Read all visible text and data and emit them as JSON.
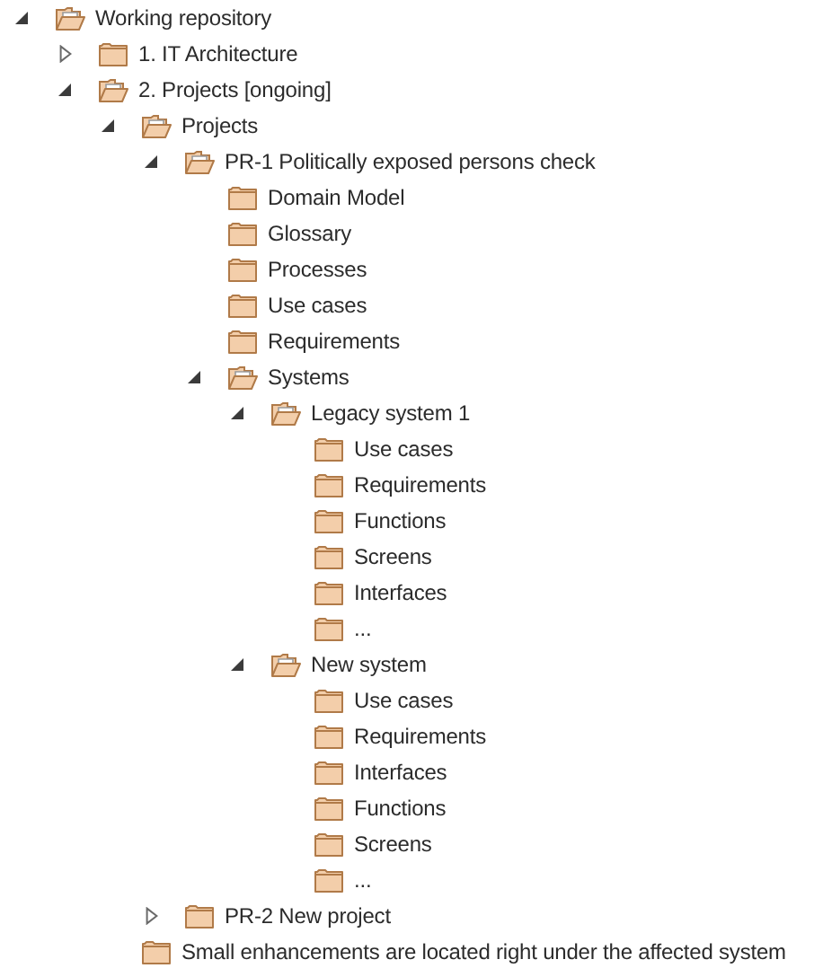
{
  "tree": [
    {
      "label": "Working repository",
      "expanded": true,
      "children": [
        {
          "label": "1. IT Architecture",
          "expanded": false
        },
        {
          "label": "2. Projects [ongoing]",
          "expanded": true,
          "children": [
            {
              "label": "Projects",
              "expanded": true,
              "children": [
                {
                  "label": "PR-1 Politically exposed persons check",
                  "expanded": true,
                  "children": [
                    {
                      "label": "Domain Model"
                    },
                    {
                      "label": "Glossary"
                    },
                    {
                      "label": "Processes"
                    },
                    {
                      "label": "Use cases"
                    },
                    {
                      "label": "Requirements"
                    },
                    {
                      "label": "Systems",
                      "expanded": true,
                      "children": [
                        {
                          "label": "Legacy system 1",
                          "expanded": true,
                          "children": [
                            {
                              "label": "Use cases"
                            },
                            {
                              "label": "Requirements"
                            },
                            {
                              "label": "Functions"
                            },
                            {
                              "label": "Screens"
                            },
                            {
                              "label": "Interfaces"
                            },
                            {
                              "label": "..."
                            }
                          ]
                        },
                        {
                          "label": "New system",
                          "expanded": true,
                          "children": [
                            {
                              "label": "Use cases"
                            },
                            {
                              "label": "Requirements"
                            },
                            {
                              "label": "Interfaces"
                            },
                            {
                              "label": "Functions"
                            },
                            {
                              "label": "Screens"
                            },
                            {
                              "label": "..."
                            }
                          ]
                        }
                      ]
                    }
                  ]
                },
                {
                  "label": "PR-2 New project",
                  "expanded": false
                }
              ]
            },
            {
              "label": "Small enhancements are located right under the affected system"
            }
          ]
        }
      ]
    }
  ]
}
